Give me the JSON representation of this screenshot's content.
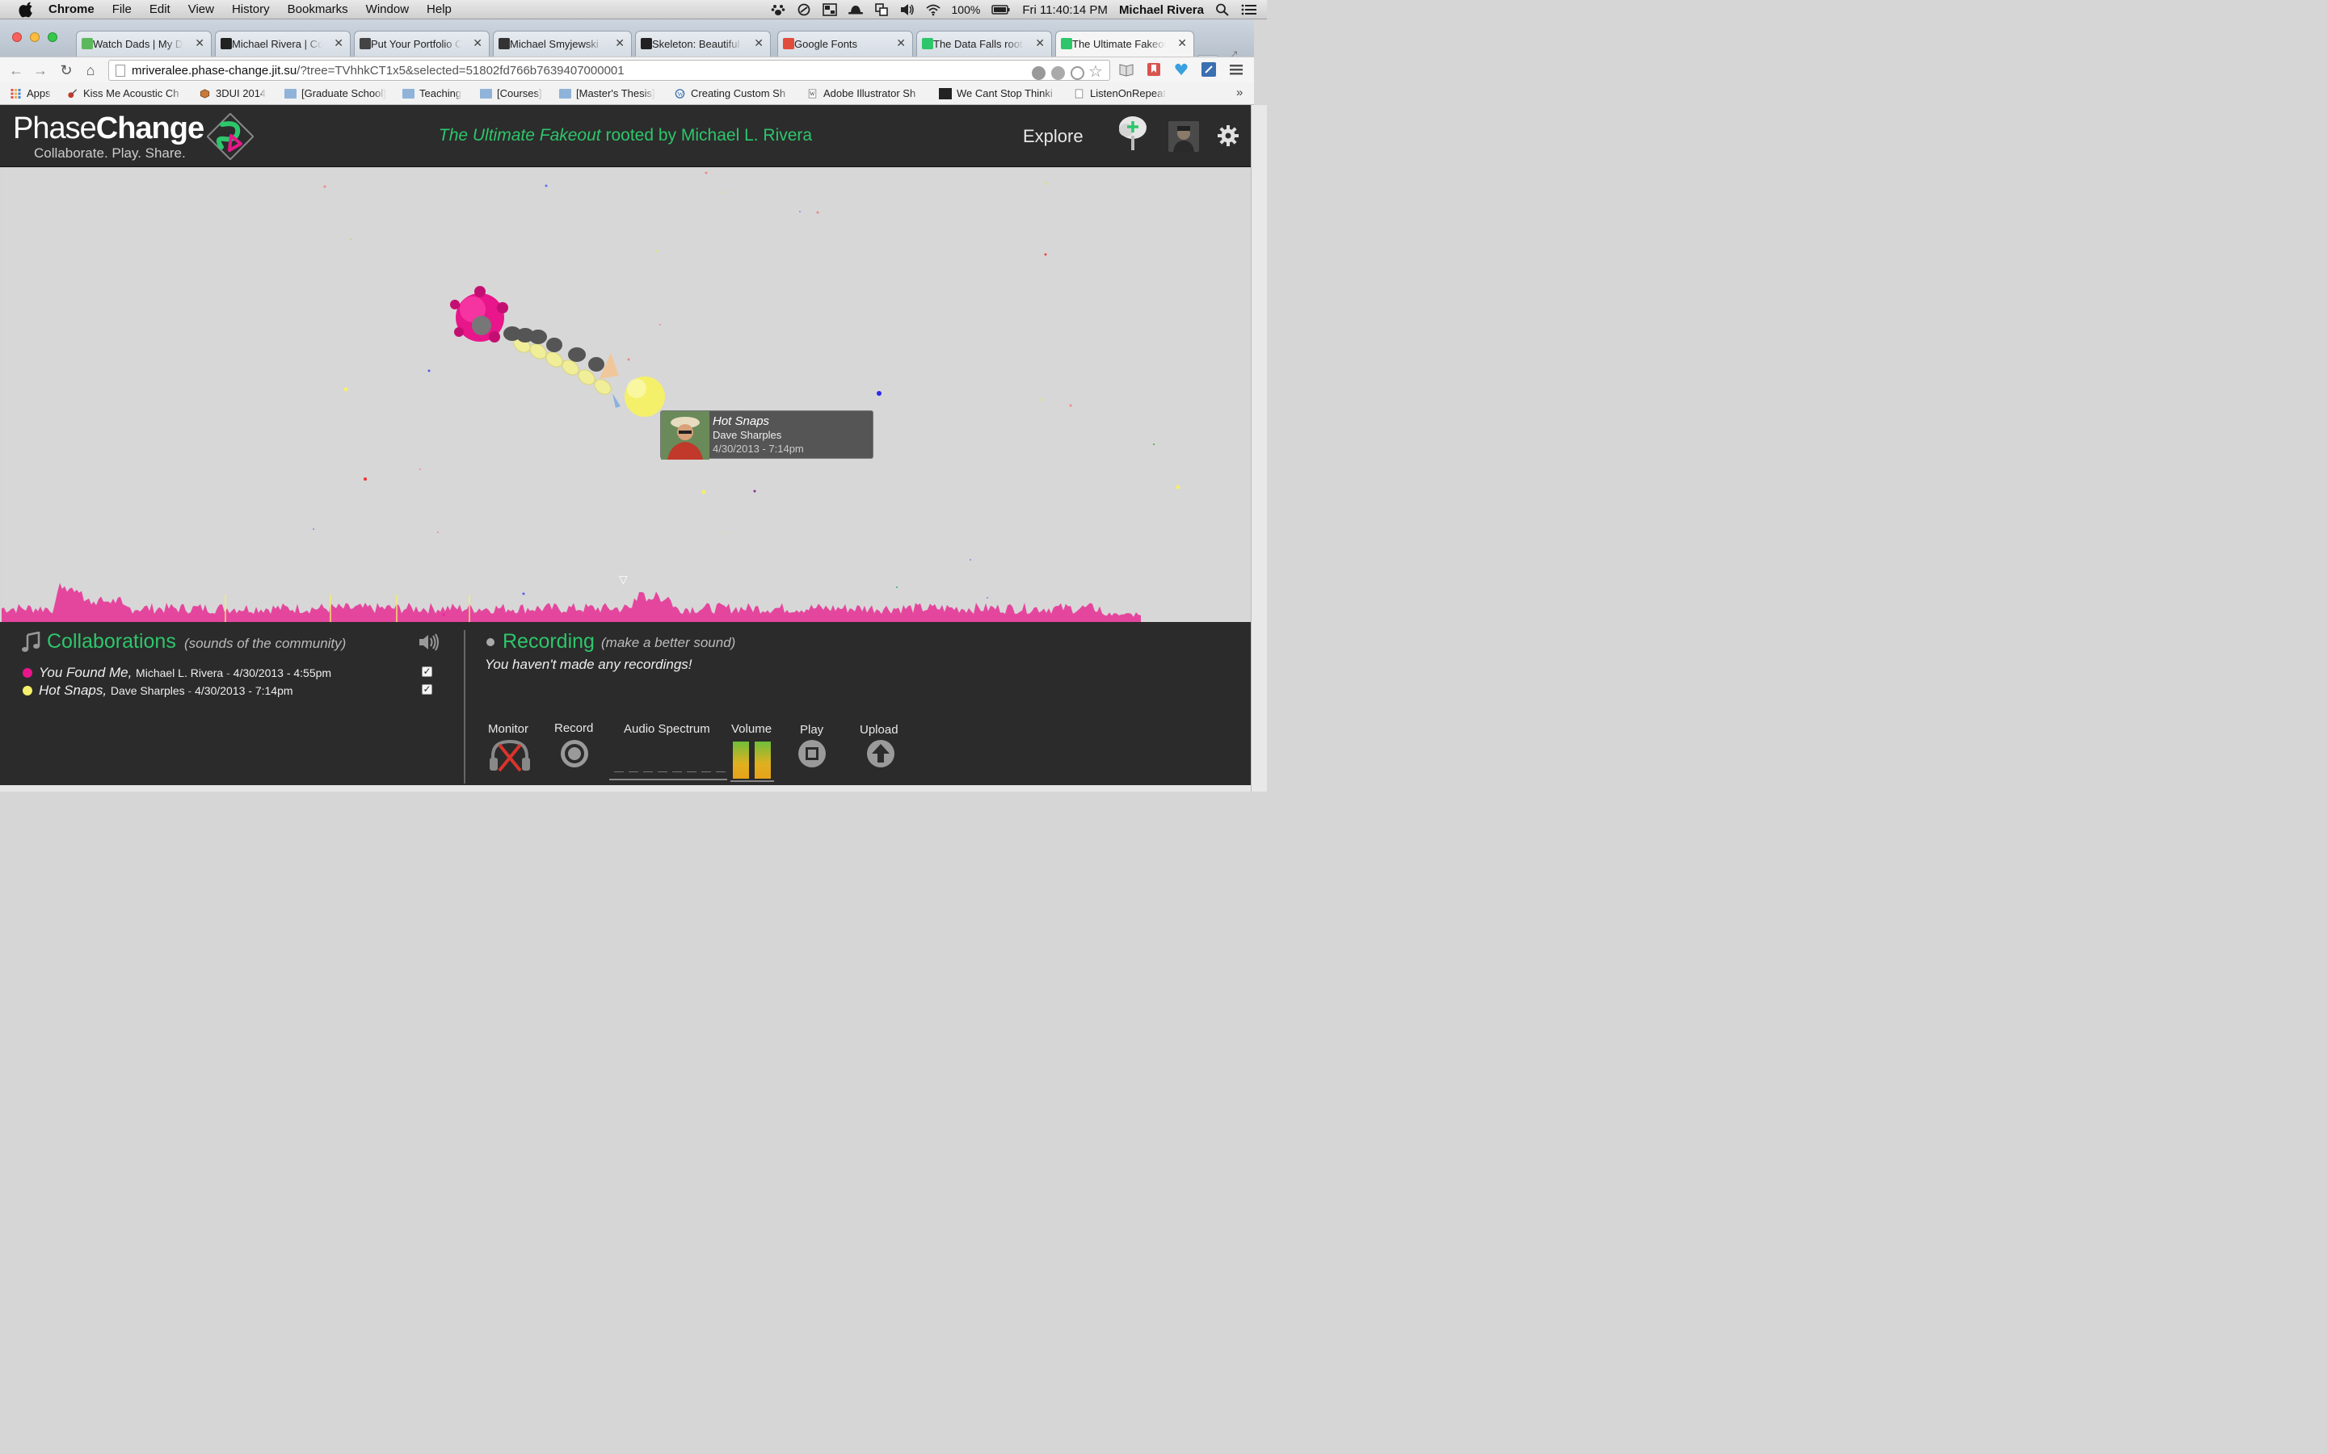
{
  "menubar": {
    "app": "Chrome",
    "items": [
      "File",
      "Edit",
      "View",
      "History",
      "Bookmarks",
      "Window",
      "Help"
    ],
    "battery": "100%",
    "clock": "Fri 11:40:14 PM",
    "user": "Michael Rivera"
  },
  "tabs": [
    {
      "label": "Watch Dads | My Da",
      "favicon_color": "#5cb85c"
    },
    {
      "label": "Michael Rivera | Co",
      "favicon_color": "#222222"
    },
    {
      "label": "Put Your Portfolio O",
      "favicon_color": "#444444"
    },
    {
      "label": "Michael Smyjewski",
      "favicon_color": "#333333"
    },
    {
      "label": "Skeleton: Beautiful B",
      "favicon_color": "#222222"
    },
    {
      "label": "Google Fonts",
      "favicon_color": "#e14c3b"
    },
    {
      "label": "The Data Falls roote",
      "favicon_color": "#2dc66b"
    },
    {
      "label": "The Ultimate Fakeou",
      "favicon_color": "#2dc66b"
    }
  ],
  "address": {
    "host": "mriveralee.phase-change.jit.su",
    "path": "/?tree=TVhhkCT1x5&selected=51802fd766b7639407000001"
  },
  "bookmarks": [
    {
      "label": "Apps",
      "icon": "apps-grid-icon"
    },
    {
      "label": "Kiss Me Acoustic Ch",
      "icon": "guitar-icon"
    },
    {
      "label": "3DUI 2014",
      "icon": "cube-icon"
    },
    {
      "label": "[Graduate School]",
      "icon": "folder-icon"
    },
    {
      "label": "Teaching",
      "icon": "folder-icon"
    },
    {
      "label": "[Courses]",
      "icon": "folder-icon"
    },
    {
      "label": "[Master's Thesis]",
      "icon": "folder-icon"
    },
    {
      "label": "Creating Custom Sh",
      "icon": "wordpress-icon"
    },
    {
      "label": "Adobe Illustrator Sh",
      "icon": "page-icon"
    },
    {
      "label": "We Cant Stop Thinki",
      "icon": "square-icon"
    },
    {
      "label": "ListenOnRepeat",
      "icon": "page-icon"
    }
  ],
  "header": {
    "logo_light": "Phase",
    "logo_bold": "Change",
    "tagline": "Collaborate. Play. Share.",
    "tree_title": "The Ultimate Fakeout",
    "rooted_by": " rooted by Michael L. Rivera",
    "explore": "Explore"
  },
  "tooltip": {
    "title": "Hot Snaps",
    "author": "Dave Sharples",
    "date": "4/30/2013 - 7:14pm"
  },
  "collaborations": {
    "heading": "Collaborations",
    "subheading": "(sounds of the community)",
    "items": [
      {
        "title": "You Found Me,",
        "author": "Michael L. Rivera",
        "date": "4/30/2013 - 4:55pm",
        "color": "#e8168a",
        "checked": "✓"
      },
      {
        "title": "Hot Snaps,",
        "author": "Dave Sharples",
        "date": "4/30/2013 - 7:14pm",
        "color": "#f4f06a",
        "checked": "✓"
      }
    ]
  },
  "recording": {
    "heading": "Recording",
    "subheading": "(make a better sound)",
    "empty": "You haven't made any recordings!",
    "controls": {
      "monitor": "Monitor",
      "record": "Record",
      "spectrum": "Audio Spectrum",
      "volume": "Volume",
      "play": "Play",
      "upload": "Upload"
    }
  },
  "colors": {
    "accent_green": "#2dc66b",
    "magenta": "#e8168a",
    "yellow": "#f4f06a",
    "panel_bg": "#2b2b2b"
  }
}
